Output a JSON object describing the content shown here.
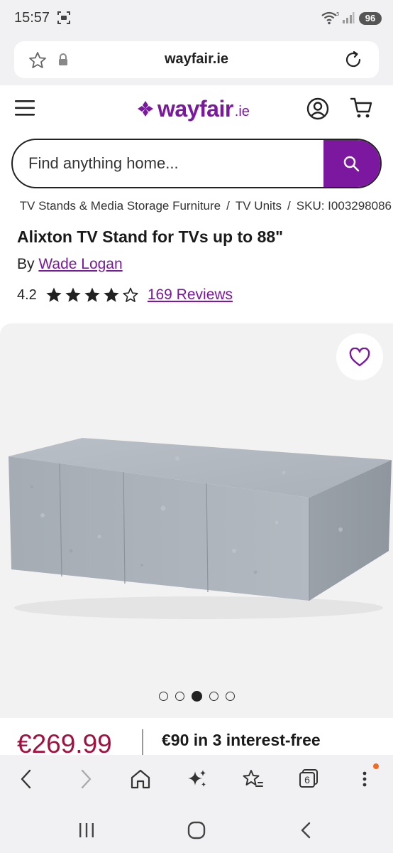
{
  "status_bar": {
    "time": "15:57",
    "battery": "96"
  },
  "browser": {
    "url": "wayfair.ie",
    "tab_count": "6"
  },
  "site": {
    "logo_word": "wayfair",
    "logo_tld": ".ie",
    "brand_color": "#7b189f",
    "search_placeholder": "Find anything home..."
  },
  "breadcrumb": {
    "items": [
      "TV Stands & Media Storage Furniture",
      "TV Units",
      "SKU: I003298086"
    ]
  },
  "product": {
    "title": "Alixton TV Stand for TVs up to 88\"",
    "by_label": "By",
    "brand": "Wade Logan",
    "rating": "4.2",
    "rating_value": 4.2,
    "rating_max": 5,
    "reviews_label": "169 Reviews",
    "price": "€269.99",
    "price_color": "#a50f3f",
    "finance_text": "€90 in 3 interest-free"
  },
  "gallery": {
    "image_count": 5,
    "active_index": 2
  }
}
